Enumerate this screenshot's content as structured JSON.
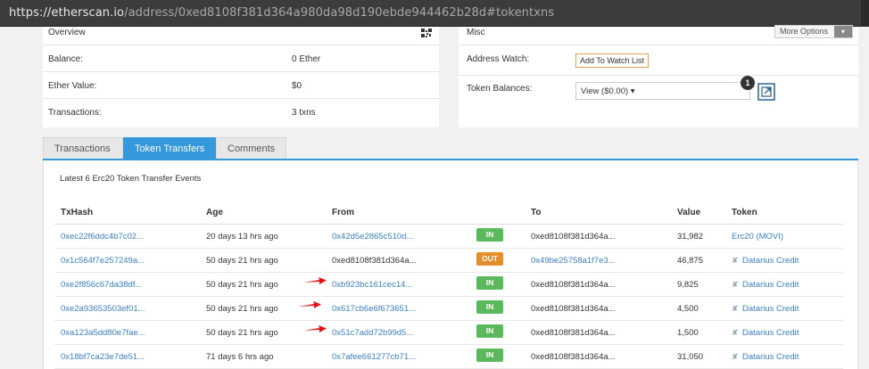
{
  "browser": {
    "url_host": "https://etherscan.io",
    "url_rest": "/address/0xed8108f381d364a980da98d190ebde944462b28d#tokentxns"
  },
  "overview": {
    "title": "Overview",
    "rows": [
      {
        "label": "Balance:",
        "value": "0 Ether"
      },
      {
        "label": "Ether Value:",
        "value": "$0"
      },
      {
        "label": "Transactions:",
        "value": "3 txns"
      }
    ]
  },
  "misc": {
    "title": "Misc",
    "more_options": "More Options",
    "address_watch_label": "Address Watch:",
    "watch_button": "Add To Watch List",
    "token_balances_label": "Token Balances:",
    "token_dropdown": "View ($0.00) ▾",
    "token_count": "1"
  },
  "tabs": [
    {
      "label": "Transactions",
      "active": false
    },
    {
      "label": "Token Transfers",
      "active": true
    },
    {
      "label": "Comments",
      "active": false
    }
  ],
  "summary": "Latest 6 Erc20 Token Transfer Events",
  "columns": [
    "TxHash",
    "Age",
    "From",
    "To",
    "Value",
    "Token"
  ],
  "rows": [
    {
      "hash": "0xec22f6ddc4b7c02...",
      "age": "20 days 13 hrs ago",
      "from": "0x42d5e2865c510d...",
      "from_link": true,
      "dir": "IN",
      "to": "0xed8108f381d364a...",
      "to_link": false,
      "value": "31,982",
      "token": "Erc20 (MOVI)",
      "token_icon": false,
      "arrow": false
    },
    {
      "hash": "0x1c564f7e257249a...",
      "age": "50 days 21 hrs ago",
      "from": "0xed8108f381d364a...",
      "from_link": false,
      "dir": "OUT",
      "to": "0x49be25758a1f7e3...",
      "to_link": true,
      "value": "46,875",
      "token": "Datarius Credit",
      "token_icon": true,
      "arrow": false
    },
    {
      "hash": "0xe2f856c67da38df...",
      "age": "50 days 21 hrs ago",
      "from": "0xb923bc161cec14...",
      "from_link": true,
      "dir": "IN",
      "to": "0xed8108f381d364a...",
      "to_link": false,
      "value": "9,825",
      "token": "Datarius Credit",
      "token_icon": true,
      "arrow": true
    },
    {
      "hash": "0xe2a93653503ef01...",
      "age": "50 days 21 hrs ago",
      "from": "0x617cb6e6f673651...",
      "from_link": true,
      "dir": "IN",
      "to": "0xed8108f381d364a...",
      "to_link": false,
      "value": "4,500",
      "token": "Datarius Credit",
      "token_icon": true,
      "arrow": true
    },
    {
      "hash": "0xa123a5dd80e7fae...",
      "age": "50 days 21 hrs ago",
      "from": "0x51c7add72b99d5...",
      "from_link": true,
      "dir": "IN",
      "to": "0xed8108f381d364a...",
      "to_link": false,
      "value": "1,500",
      "token": "Datarius Credit",
      "token_icon": true,
      "arrow": true
    },
    {
      "hash": "0x18bf7ca23e7de51...",
      "age": "71 days 6 hrs ago",
      "from": "0x7afee661277cb71...",
      "from_link": true,
      "dir": "IN",
      "to": "0xed8108f381d364a...",
      "to_link": false,
      "value": "31,050",
      "token": "Datarius Credit",
      "token_icon": true,
      "arrow": false
    }
  ],
  "colors": {
    "accent": "#3498db",
    "link": "#3b7fc4",
    "in": "#5cb85c",
    "out": "#e38d2b",
    "annotation_arrow": "#e0141c"
  }
}
